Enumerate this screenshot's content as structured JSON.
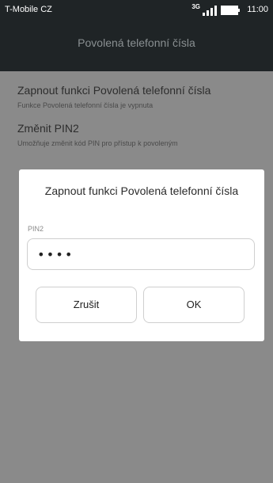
{
  "status_bar": {
    "carrier": "T-Mobile CZ",
    "network_type": "3G",
    "time": "11:00",
    "icons": [
      "signal-icon",
      "battery-icon"
    ]
  },
  "header": {
    "title": "Povolená telefonní čísla"
  },
  "settings": {
    "items": [
      {
        "title": "Zapnout funkci Povolená telefonní čísla",
        "subtitle": "Funkce Povolená telefonní čísla je vypnuta"
      },
      {
        "title": "Změnit PIN2",
        "subtitle": "Umožňuje změnit kód PIN pro přístup k povoleným"
      }
    ]
  },
  "dialog": {
    "title": "Zapnout funkci Povolená telefonní čísla",
    "pin_label": "PIN2",
    "pin_value": "••••",
    "cancel_label": "Zrušit",
    "ok_label": "OK"
  },
  "colors": {
    "status_bar_bg": "#1f2426",
    "screen_dim_bg": "#8a8a8a",
    "dialog_bg": "#ffffff",
    "title_text": "#8a9092"
  }
}
